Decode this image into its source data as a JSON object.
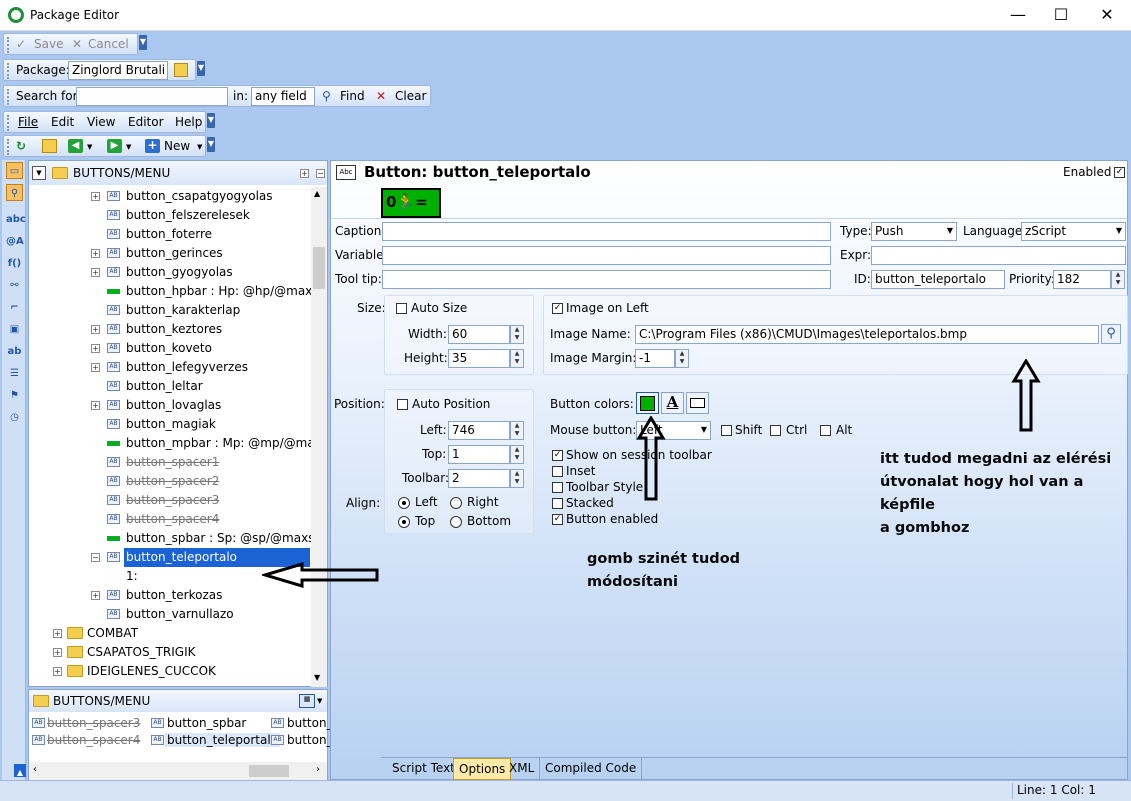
{
  "window": {
    "title": "Package Editor",
    "minimize": "—",
    "maximize": "☐",
    "close": "✕"
  },
  "toolbar1": {
    "save": "Save",
    "cancel": "Cancel"
  },
  "toolbar2": {
    "package_label": "Package:",
    "package_value": "Zinglord Brutali"
  },
  "toolbar3": {
    "search_label": "Search for:",
    "search_value": "",
    "in_label": "in:",
    "field_value": "any field",
    "find": "Find",
    "clear": "Clear"
  },
  "menu": {
    "file": "File",
    "edit": "Edit",
    "view": "View",
    "editor": "Editor",
    "help": "Help"
  },
  "toolbar5": {
    "new": "New"
  },
  "tree": {
    "root": "BUTTONS/MENU",
    "items": [
      {
        "label": "button_csapatgyogyolas",
        "kind": "ab",
        "exp": "+"
      },
      {
        "label": "button_felszerelesek",
        "kind": "ab",
        "exp": ""
      },
      {
        "label": "button_foterre",
        "kind": "ab",
        "exp": ""
      },
      {
        "label": "button_gerinces",
        "kind": "ab",
        "exp": "+"
      },
      {
        "label": "button_gyogyolas",
        "kind": "ab",
        "exp": "+"
      },
      {
        "label": "button_hpbar : Hp: @hp/@maxhp",
        "kind": "bar",
        "exp": ""
      },
      {
        "label": "button_karakterlap",
        "kind": "ab",
        "exp": ""
      },
      {
        "label": "button_keztores",
        "kind": "ab",
        "exp": "+"
      },
      {
        "label": "button_koveto",
        "kind": "ab",
        "exp": "+"
      },
      {
        "label": "button_lefegyverzes",
        "kind": "ab",
        "exp": "+"
      },
      {
        "label": "button_leltar",
        "kind": "ab",
        "exp": ""
      },
      {
        "label": "button_lovaglas",
        "kind": "ab",
        "exp": "+"
      },
      {
        "label": "button_magiak",
        "kind": "ab",
        "exp": ""
      },
      {
        "label": "button_mpbar : Mp: @mp/@maxn",
        "kind": "bar",
        "exp": ""
      },
      {
        "label": "button_spacer1",
        "kind": "ab",
        "exp": "",
        "strike": true
      },
      {
        "label": "button_spacer2",
        "kind": "ab",
        "exp": "",
        "strike": true
      },
      {
        "label": "button_spacer3",
        "kind": "ab",
        "exp": "",
        "strike": true
      },
      {
        "label": "button_spacer4",
        "kind": "ab",
        "exp": "",
        "strike": true
      },
      {
        "label": "button_spbar : Sp: @sp/@maxsp (",
        "kind": "bar",
        "exp": ""
      },
      {
        "label": "button_teleportalo",
        "kind": "ab",
        "exp": "−",
        "selected": true
      },
      {
        "label": "1:",
        "kind": "child",
        "exp": ""
      },
      {
        "label": "button_terkozas",
        "kind": "ab",
        "exp": "+"
      },
      {
        "label": "button_varnullazo",
        "kind": "ab",
        "exp": ""
      }
    ],
    "folders": [
      "COMBAT",
      "CSAPATOS_TRIGIK",
      "IDEIGLENES_CUCCOK"
    ]
  },
  "bottom": {
    "title": "BUTTONS/MENU",
    "c1r1": "button_spacer3",
    "c1r2": "button_spacer4",
    "c2r1": "button_spbar",
    "c2r2": "button_teleportalo",
    "c3r1": "button_",
    "c3r2": "button_"
  },
  "main": {
    "title": "Button: button_teleportalo",
    "title_icon": "Abc",
    "enabled_label": "Enabled",
    "enabled_checked": true,
    "caption_label": "Caption:",
    "caption_value": "",
    "variable_label": "Variable:",
    "variable_value": "",
    "tooltip_label": "Tool tip:",
    "tooltip_value": "",
    "type_label": "Type:",
    "type_value": "Push",
    "language_label": "Language:",
    "language_value": "zScript",
    "expr_label": "Expr:",
    "expr_value": "",
    "id_label": "ID:",
    "id_value": "button_teleportalo",
    "priority_label": "Priority:",
    "priority_value": "182",
    "size_label": "Size:",
    "autosize": "Auto Size",
    "width_label": "Width:",
    "width_value": "60",
    "height_label": "Height:",
    "height_value": "35",
    "image_on_left": "Image on Left",
    "image_name_label": "Image Name:",
    "image_name_value": "C:\\Program Files (x86)\\CMUD\\Images\\teleportalos.bmp",
    "image_margin_label": "Image Margin:",
    "image_margin_value": "-1",
    "position_label": "Position:",
    "autoposition": "Auto Position",
    "left_label": "Left:",
    "left_value": "746",
    "top_label": "Top:",
    "top_value": "1",
    "toolbar_label": "Toolbar:",
    "toolbar_value": "2",
    "align_label": "Align:",
    "align_left": "Left",
    "align_right": "Right",
    "align_top": "Top",
    "align_bottom": "Bottom",
    "button_colors_label": "Button colors:",
    "mouse_button_label": "Mouse button:",
    "mouse_button_value": "Left",
    "shift": "Shift",
    "ctrl": "Ctrl",
    "alt": "Alt",
    "show_on_session_toolbar": "Show on session toolbar",
    "inset": "Inset",
    "toolbar_style": "Toolbar Style",
    "stacked": "Stacked",
    "button_enabled": "Button enabled"
  },
  "annotations": {
    "a1_line1": "itt tudod megadni az elérési",
    "a1_line2": "útvonalat hogy hol van a képfile",
    "a1_line3": "a gombhoz",
    "a2_line1": "gomb szinét tudod",
    "a2_line2": "módosítani"
  },
  "tabs": [
    "Script Text",
    "Options",
    "XML",
    "Compiled Code"
  ],
  "status": {
    "position": "Line: 1 Col: 1"
  },
  "colors": {
    "accent": "#1b62d4",
    "button_color": "#00b000",
    "options_tab": "#fde9a8"
  }
}
